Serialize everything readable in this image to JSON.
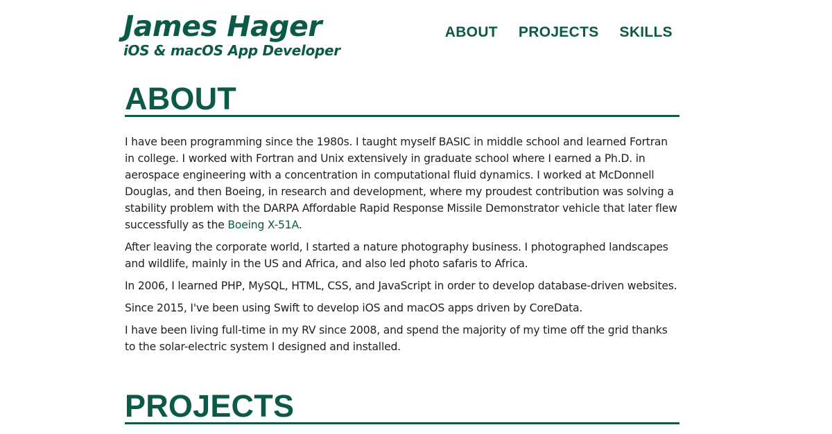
{
  "header": {
    "name": "James Hager",
    "tagline": "iOS & macOS App Developer",
    "nav": [
      {
        "label": "ABOUT"
      },
      {
        "label": "PROJECTS"
      },
      {
        "label": "SKILLS"
      }
    ]
  },
  "about": {
    "title": "ABOUT",
    "p1_before_link": "I have been programming since the 1980s. I taught myself BASIC in middle school and learned Fortran in college. I worked with Fortran and Unix extensively in graduate school where I earned a Ph.D. in aerospace engineering with a concentration in computational fluid dynamics. I worked at McDonnell Douglas, and then Boeing, in research and development, where my proudest contribution was solving a stability problem with the DARPA Affordable Rapid Response Missile Demonstrator vehicle that later flew successfully as the ",
    "p1_link": "Boeing X-51A",
    "p1_after_link": ".",
    "p2": "After leaving the corporate world, I started a nature photography business. I photographed landscapes and wildlife, mainly in the US and Africa, and also led photo safaris to Africa.",
    "p3": "In 2006, I learned PHP, MySQL, HTML, CSS, and JavaScript in order to develop database-driven websites.",
    "p4": "Since 2015, I've been using Swift to develop iOS and macOS apps driven by CoreData.",
    "p5": "I have been living full-time in my RV since 2008, and spend the majority of my time off the grid thanks to the solar-electric system I designed and installed."
  },
  "projects": {
    "title": "PROJECTS"
  },
  "colors": {
    "accent": "#0b5a47",
    "text": "#1f1f1f",
    "background": "#ffffff"
  }
}
